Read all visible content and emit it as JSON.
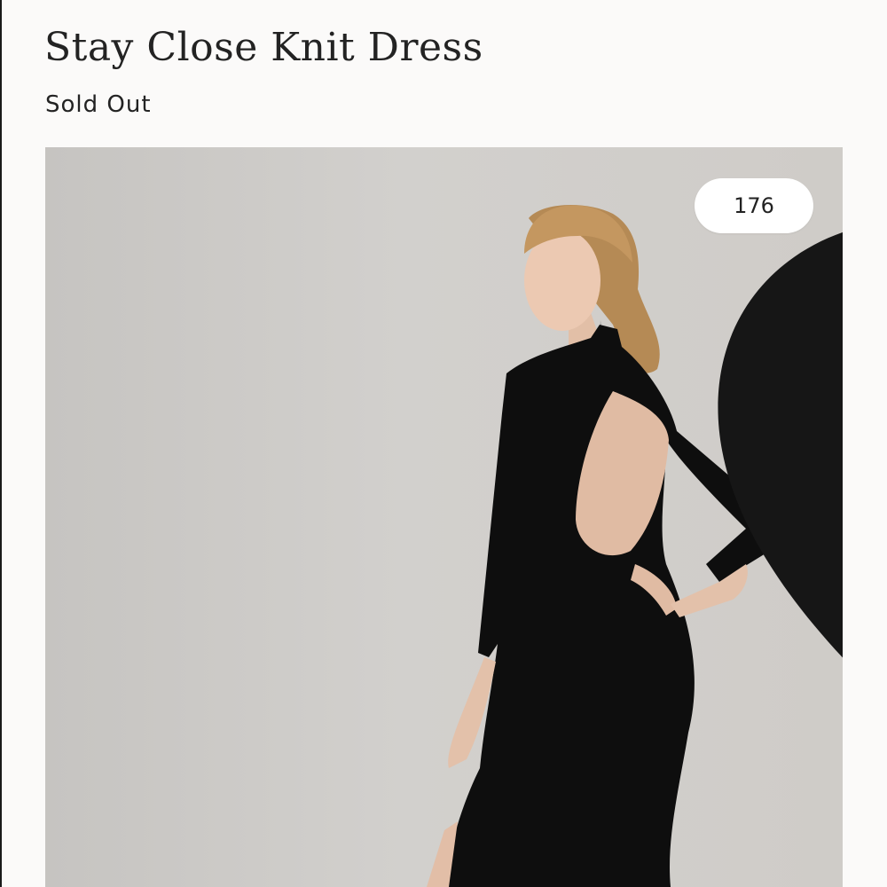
{
  "product": {
    "title": "Stay Close Knit Dress",
    "status": "Sold Out",
    "likes": "176"
  },
  "icons": {
    "like": "heart-icon"
  },
  "colors": {
    "text": "#232323",
    "background": "#fbfaf9",
    "dress": "#0d0d0d"
  }
}
